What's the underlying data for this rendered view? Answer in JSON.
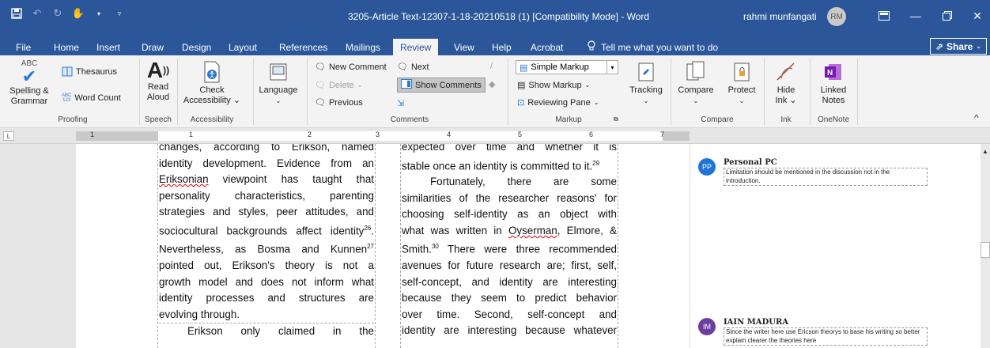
{
  "titlebar": {
    "document_title": "3205-Article Text-12307-1-18-20210518 (1) [Compatibility Mode] - Word",
    "user_name": "rahmi munfangati",
    "user_initials": "RM",
    "icons": [
      "save-icon",
      "undo-icon",
      "redo-icon",
      "touch-mode-icon",
      "customize-qat-icon",
      "ribbon-display-icon",
      "minimize-icon",
      "restore-icon",
      "close-icon"
    ]
  },
  "tabs": [
    {
      "label": "File"
    },
    {
      "label": "Home"
    },
    {
      "label": "Insert"
    },
    {
      "label": "Draw"
    },
    {
      "label": "Design"
    },
    {
      "label": "Layout"
    },
    {
      "label": "References"
    },
    {
      "label": "Mailings"
    },
    {
      "label": "Review",
      "active": true
    },
    {
      "label": "View"
    },
    {
      "label": "Help"
    },
    {
      "label": "Acrobat"
    }
  ],
  "tell_me": "Tell me what you want to do",
  "share_label": "Share",
  "ribbon": {
    "proofing": {
      "spelling": "Spelling &",
      "spelling2": "Grammar",
      "spelling_icon_text": "ABC",
      "thesaurus": "Thesaurus",
      "word_count": "Word Count",
      "word_count_icon_text": "ABC",
      "group": "Proofing"
    },
    "speech": {
      "read": "Read",
      "read2": "Aloud",
      "group": "Speech"
    },
    "accessibility": {
      "check": "Check",
      "check2": "Accessibility",
      "group": "Accessibility"
    },
    "language": {
      "label": "Language"
    },
    "comments": {
      "new_comment": "New Comment",
      "delete": "Delete",
      "previous": "Previous",
      "next": "Next",
      "show_comments": "Show Comments",
      "group": "Comments"
    },
    "markup": {
      "simple_markup": "Simple Markup",
      "show_markup": "Show Markup",
      "reviewing_pane": "Reviewing Pane",
      "tracking": "Tracking",
      "group": "Markup"
    },
    "compare": {
      "compare": "Compare",
      "protect": "Protect",
      "group": "Compare"
    },
    "ink": {
      "hide": "Hide",
      "hide2": "Ink",
      "group": "Ink"
    },
    "onenote": {
      "linked": "Linked",
      "linked2": "Notes",
      "group": "OneNote"
    },
    "accent": "#2b579a",
    "onenote_color": "#7719aa"
  },
  "ruler": {
    "numbers": [
      "1",
      "1",
      "2",
      "3",
      "4",
      "5",
      "6",
      "7"
    ]
  },
  "document": {
    "left_column": [
      "changes, according to Erikson, named",
      "identity development. Evidence from an",
      "Eriksonian viewpoint has taught that",
      "personality characteristics, parenting",
      "strategies and styles, peer attitudes, and",
      "sociocultural backgrounds affect identity",
      "Nevertheless, as Bosma and Kunnen",
      "pointed out, Erikson's theory is not a",
      "growth model and does not inform what",
      "identity processes and structures are",
      "evolving through.",
      "Erikson only claimed in the"
    ],
    "left_sup": {
      "identity": "26",
      "kunnen": "27"
    },
    "right_column": [
      "expected over time and whether it is",
      "stable once an identity is committed to it.",
      "Fortunately, there are some",
      "similarities of the researcher reasons' for",
      "choosing self-identity as an object with",
      "what was written in Oyserman, Elmore, &",
      "Smith.",
      " There were three recommended",
      "avenues for future research are; first, self,",
      "self-concept, and identity are interesting",
      "because they seem to predict behavior",
      "over time. Second, self-concept and",
      "identity are interesting because whatever"
    ],
    "right_sup": {
      "committed": "29",
      "smith": "30"
    }
  },
  "comments": [
    {
      "initials": "PP",
      "author": "Personal PC",
      "text": "Limitation should be mentioned in the discussion not in the introduction.",
      "color": "#1f74d8"
    },
    {
      "initials": "IM",
      "author": "IAIN MADURA",
      "text": "Since the writer here use Ericson theorys to base his writing so better explain clearer the theories here",
      "color": "#6b3fa0"
    }
  ]
}
